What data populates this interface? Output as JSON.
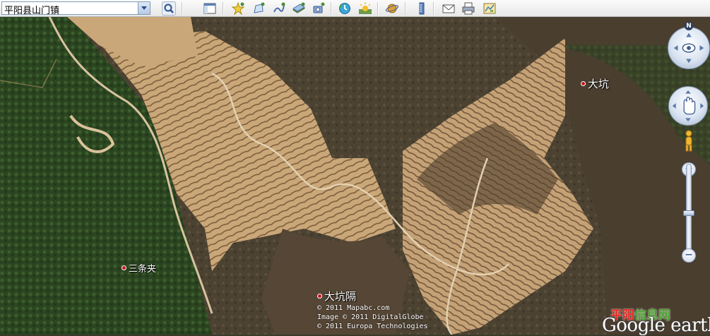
{
  "search": {
    "value": "平阳县山门镇"
  },
  "toolbar": {
    "buttons": [
      {
        "name": "search-button",
        "icon": "magnifier-icon"
      },
      {
        "name": "sidebar-toggle-button",
        "icon": "sidebar-icon"
      },
      {
        "name": "add-placemark-button",
        "icon": "pushpin-icon"
      },
      {
        "name": "add-polygon-button",
        "icon": "polygon-icon"
      },
      {
        "name": "add-path-button",
        "icon": "path-icon"
      },
      {
        "name": "add-image-overlay-button",
        "icon": "image-overlay-icon"
      },
      {
        "name": "record-tour-button",
        "icon": "camera-icon"
      },
      {
        "name": "historical-imagery-button",
        "icon": "clock-icon"
      },
      {
        "name": "sunlight-button",
        "icon": "sun-icon"
      },
      {
        "name": "switch-planet-button",
        "icon": "planet-icon"
      },
      {
        "name": "ruler-button",
        "icon": "ruler-icon"
      },
      {
        "name": "email-button",
        "icon": "envelope-icon"
      },
      {
        "name": "print-button",
        "icon": "printer-icon"
      },
      {
        "name": "view-in-maps-button",
        "icon": "map-icon"
      }
    ]
  },
  "places": [
    {
      "label": "大坑"
    },
    {
      "label": "三条夹"
    },
    {
      "label": "大坑隔"
    }
  ],
  "credits": {
    "line1": "© 2011 Mapabc.com",
    "line2": "Image © 2011 DigitalGlobe",
    "line3": "© 2011 Europa Technologies"
  },
  "navigation": {
    "north_label": "N",
    "zoom_in_label": "+",
    "zoom_out_label": "−",
    "zoom_level": 0.5
  },
  "logo": {
    "overlay_red": "平阳",
    "overlay_green": "信息网",
    "word": "Google earth"
  },
  "colors": {
    "terrace": "#c9a778",
    "forest": "#2d4a22",
    "soil": "#4a3a2a",
    "place_dot": "#c8151b"
  }
}
